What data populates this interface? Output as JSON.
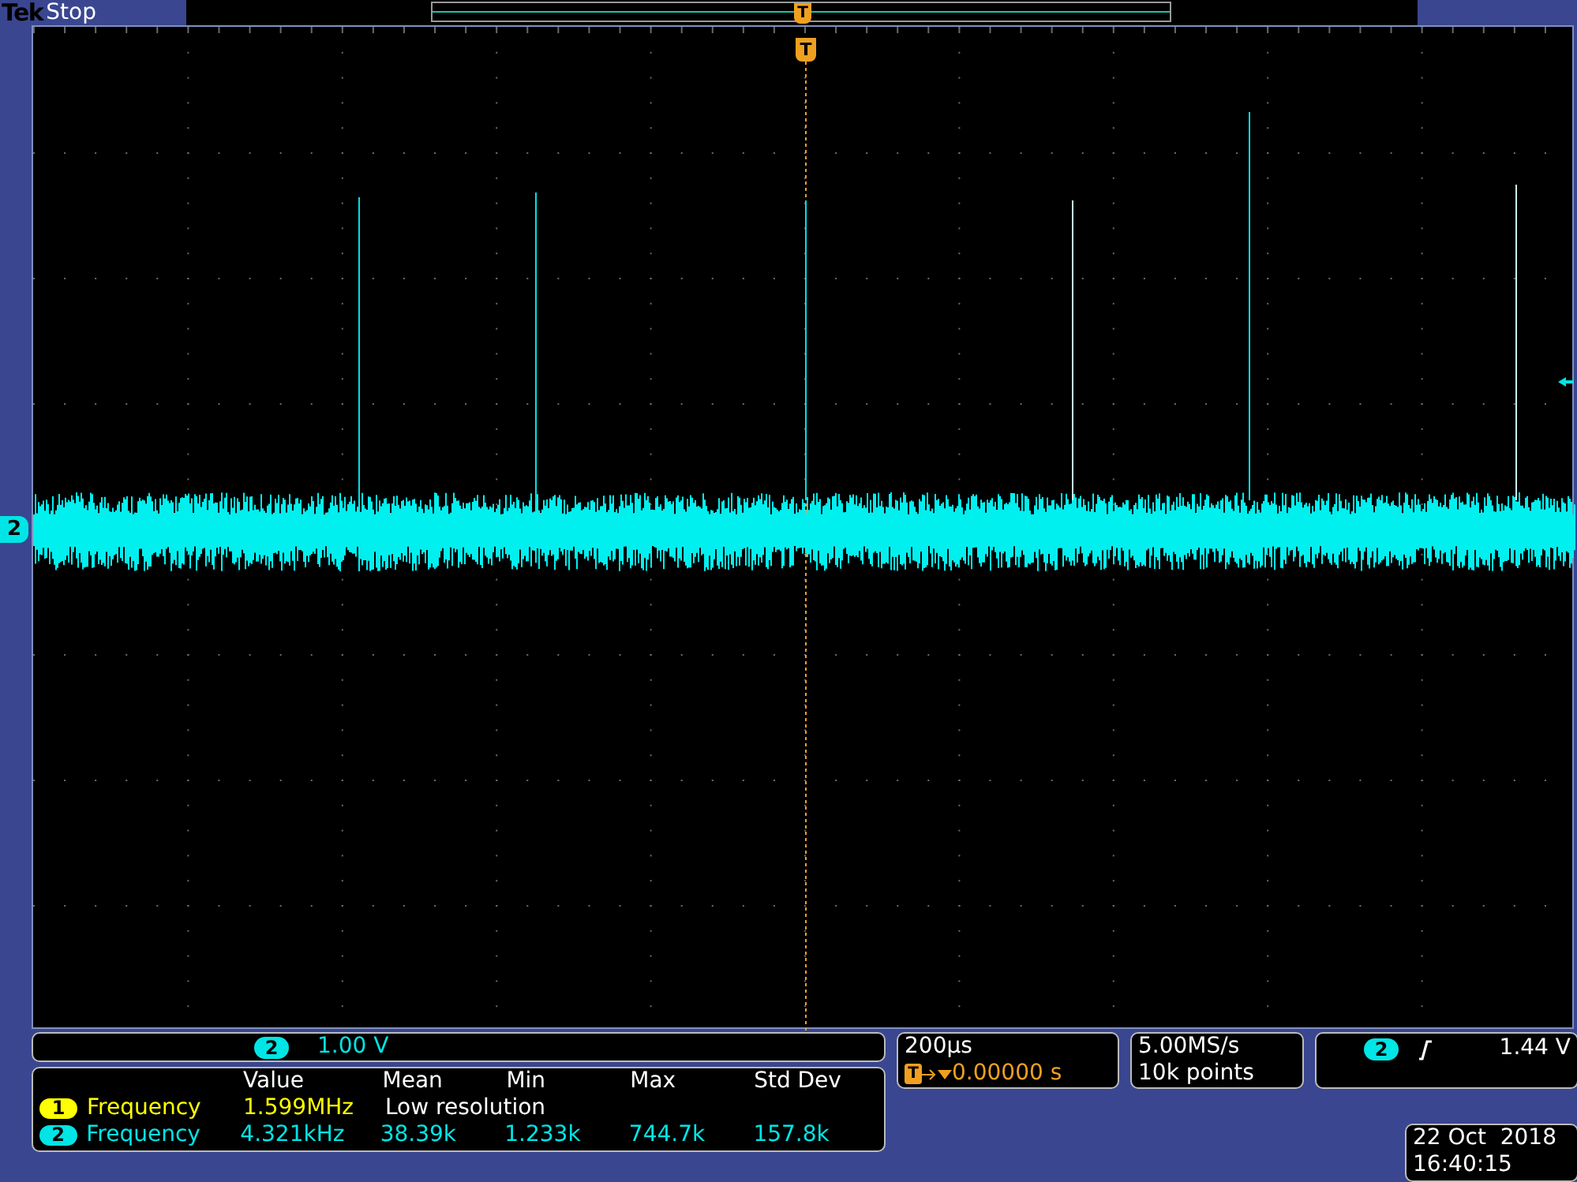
{
  "header": {
    "brand": "Tek",
    "status": "Stop"
  },
  "record_view": {
    "trigger_marker": "T"
  },
  "graticule": {
    "trigger_marker": "T",
    "channel_marker": "2"
  },
  "channel_readout": {
    "channel": "2",
    "scale": "1.00 V"
  },
  "measurements": {
    "columns": [
      "Value",
      "Mean",
      "Min",
      "Max",
      "Std Dev"
    ],
    "rows": [
      {
        "channel": "1",
        "color": "#ffff00",
        "name": "Frequency",
        "cells": [
          "1.599MHz",
          "Low resolution"
        ]
      },
      {
        "channel": "2",
        "color": "#00e5e5",
        "name": "Frequency",
        "cells": [
          "4.321kHz",
          "38.39k",
          "1.233k",
          "744.7k",
          "157.8k"
        ]
      }
    ]
  },
  "horizontal": {
    "scale": "200µs",
    "position_marker": "T",
    "position": "0.00000 s"
  },
  "acquisition": {
    "sample_rate": "5.00MS/s",
    "record_length": "10k points"
  },
  "trigger": {
    "channel": "2",
    "level": "1.44 V"
  },
  "datetime": {
    "date": "22 Oct  2018",
    "time": "16:40:15"
  }
}
